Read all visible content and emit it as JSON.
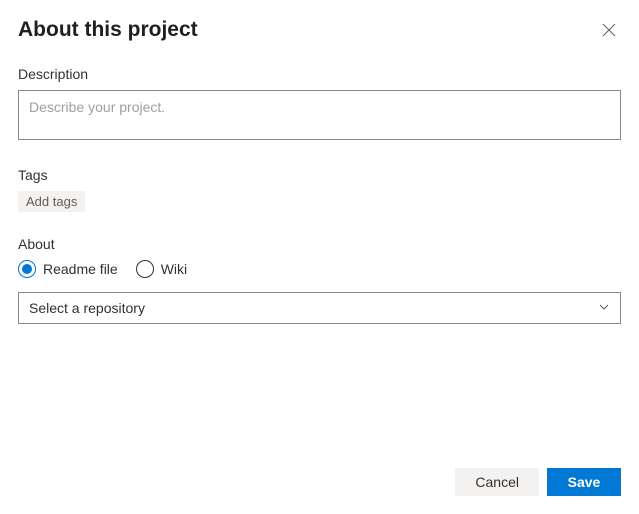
{
  "header": {
    "title": "About this project"
  },
  "description": {
    "label": "Description",
    "placeholder": "Describe your project.",
    "value": ""
  },
  "tags": {
    "label": "Tags",
    "add_label": "Add tags"
  },
  "about": {
    "label": "About",
    "options": {
      "readme": "Readme file",
      "wiki": "Wiki"
    },
    "selected": "readme",
    "repository_select": "Select a repository"
  },
  "footer": {
    "cancel": "Cancel",
    "save": "Save"
  }
}
